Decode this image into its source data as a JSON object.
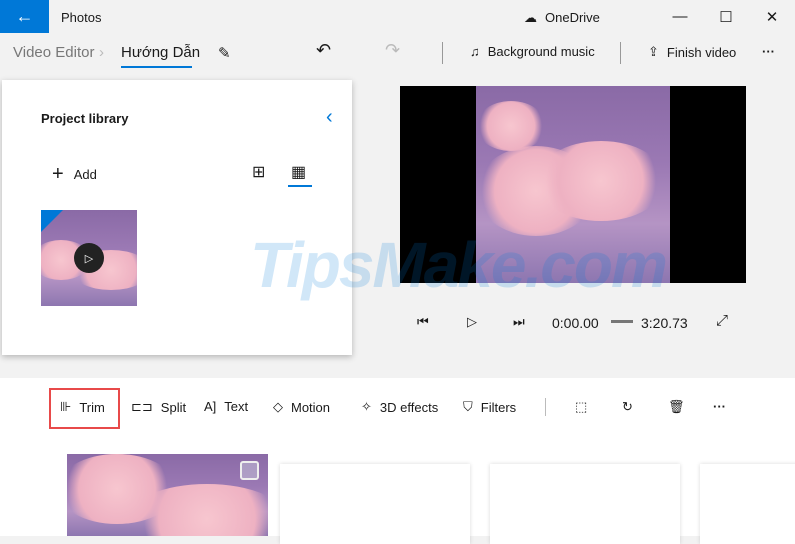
{
  "titlebar": {
    "app": "Photos",
    "onedrive": "OneDrive"
  },
  "breadcrumb": {
    "root": "Video Editor",
    "current": "Hướng Dẫn"
  },
  "toolbar": {
    "background_music": "Background music",
    "finish_video": "Finish video"
  },
  "library": {
    "title": "Project library",
    "add": "Add"
  },
  "playback": {
    "current_time": "0:00.00",
    "total_time": "3:20.73",
    "progress": 0
  },
  "storyboard": {
    "tools": [
      "Trim",
      "Split",
      "Text",
      "Motion",
      "3D effects",
      "Filters"
    ]
  },
  "watermark": "TipsMake.com",
  "colors": {
    "accent": "#0078d7",
    "highlight": "#e84a4a"
  }
}
